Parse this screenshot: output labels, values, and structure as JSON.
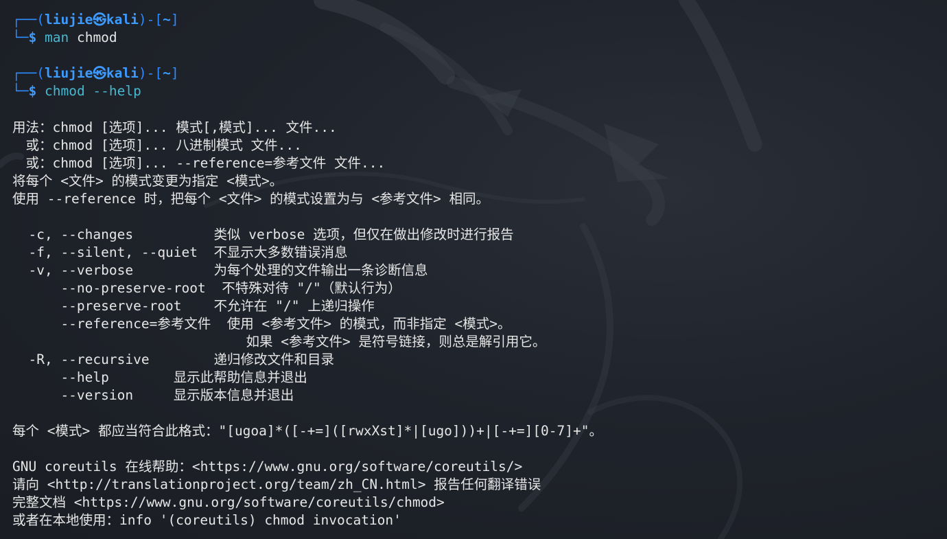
{
  "colors": {
    "background": "#1c1f26",
    "prompt_blue": "#3d9bff",
    "command_cyan": "#48b8d0",
    "text": "#e6e6e6"
  },
  "prompts": [
    {
      "box_top": "┌──(",
      "user_host": "liujie㉿kali",
      "close": ")-[",
      "cwd": "~",
      "end": "]",
      "box_bottom": "└─",
      "dollar": "$",
      "command": "man",
      "args": " chmod"
    },
    {
      "box_top": "┌──(",
      "user_host": "liujie㉿kali",
      "close": ")-[",
      "cwd": "~",
      "end": "]",
      "box_bottom": "└─",
      "dollar": "$",
      "command": "chmod",
      "args": " --help"
    }
  ],
  "output_lines": [
    "用法：chmod [选项]... 模式[,模式]... 文件...",
    "　或：chmod [选项]... 八进制模式 文件...",
    "　或：chmod [选项]... --reference=参考文件 文件...",
    "将每个 <文件> 的模式变更为指定 <模式>。",
    "使用 --reference 时，把每个 <文件> 的模式设置为与 <参考文件> 相同。",
    "",
    "  -c, --changes          类似 verbose 选项，但仅在做出修改时进行报告",
    "  -f, --silent, --quiet  不显示大多数错误消息",
    "  -v, --verbose          为每个处理的文件输出一条诊断信息",
    "      --no-preserve-root  不特殊对待 \"/\"（默认行为）",
    "      --preserve-root    不允许在 \"/\" 上递归操作",
    "      --reference=参考文件  使用 <参考文件> 的模式，而非指定 <模式>。",
    "                             如果 <参考文件> 是符号链接，则总是解引用它。",
    "  -R, --recursive        递归修改文件和目录",
    "      --help        显示此帮助信息并退出",
    "      --version     显示版本信息并退出",
    "",
    "每个 <模式> 都应当符合此格式：\"[ugoa]*([-+=]([rwxXst]*|[ugo]))+|[-+=][0-7]+\"。",
    "",
    "GNU coreutils 在线帮助：<https://www.gnu.org/software/coreutils/>",
    "请向 <http://translationproject.org/team/zh_CN.html> 报告任何翻译错误",
    "完整文档 <https://www.gnu.org/software/coreutils/chmod>",
    "或者在本地使用：info '(coreutils) chmod invocation'"
  ]
}
